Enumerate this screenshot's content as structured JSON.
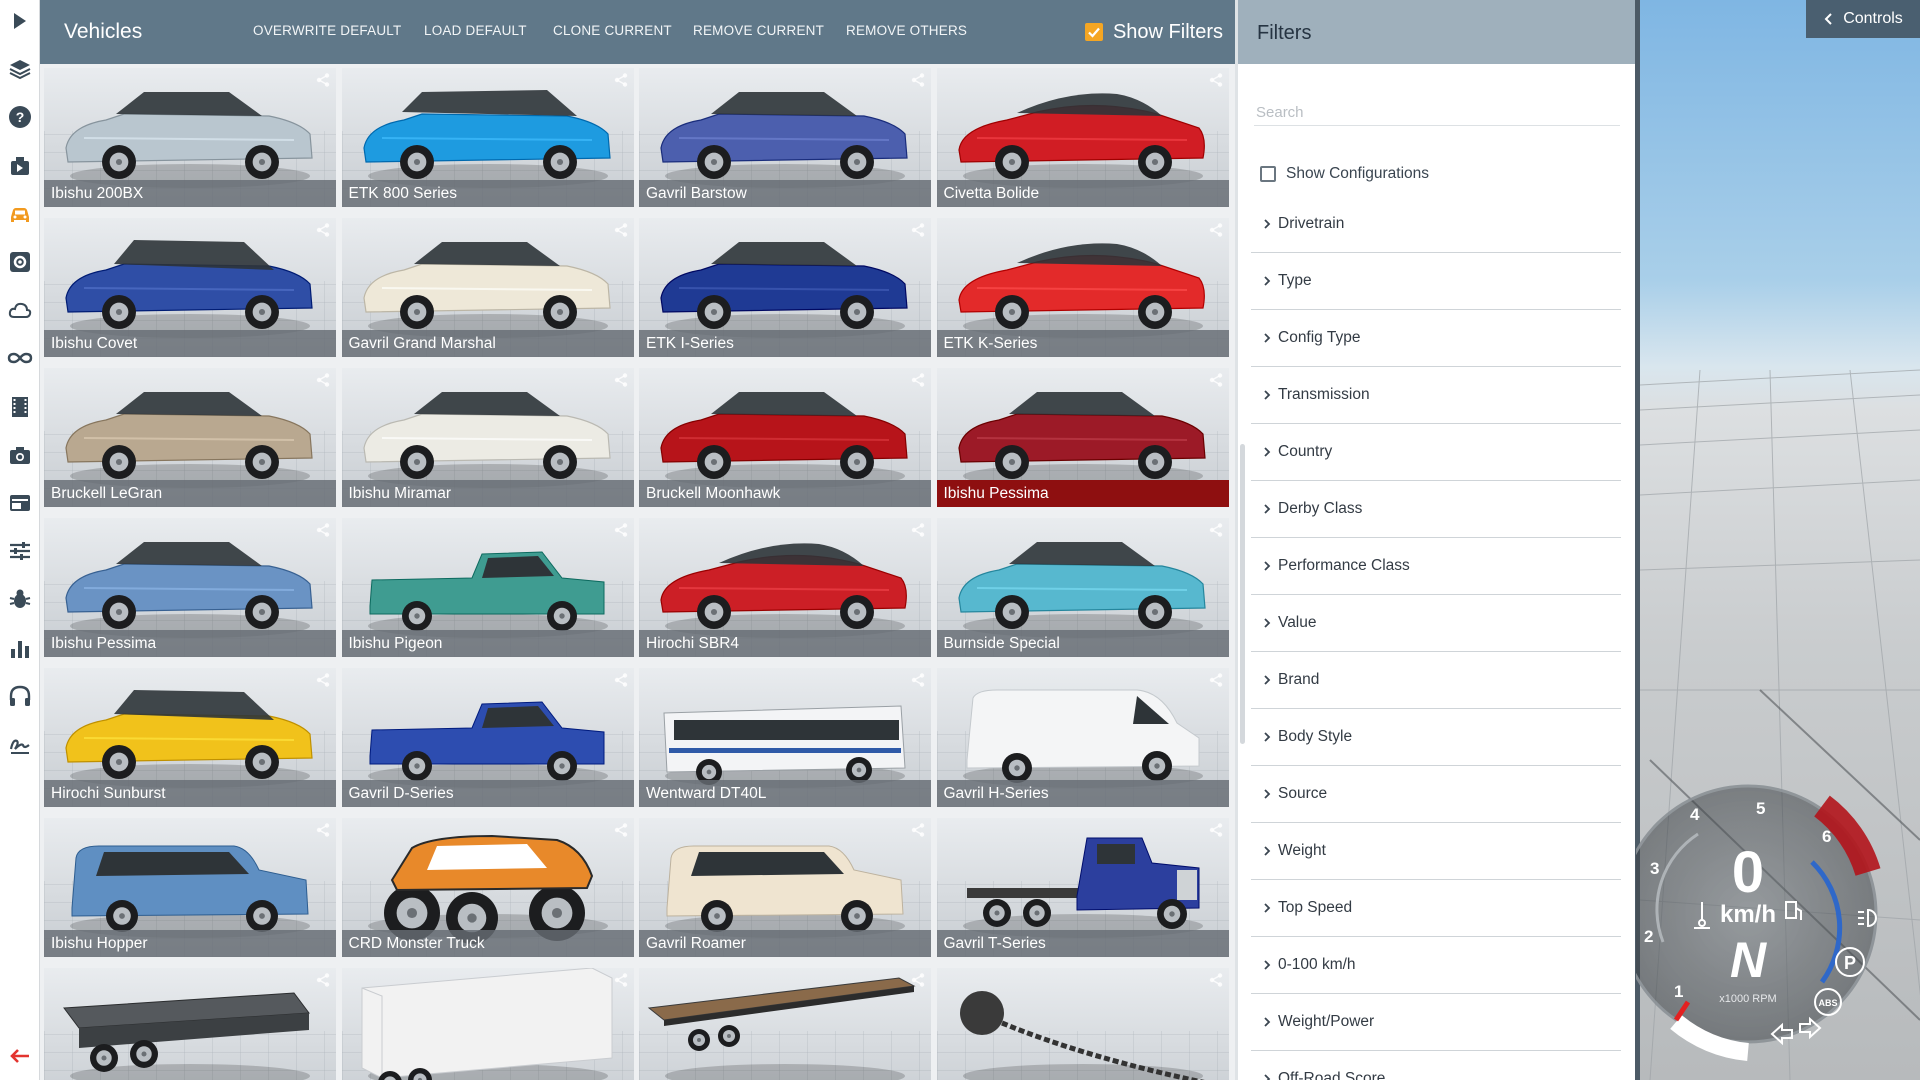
{
  "toolbar": {
    "items": [
      {
        "name": "play-icon"
      },
      {
        "name": "layers-icon"
      },
      {
        "name": "help-icon"
      },
      {
        "name": "scenario-icon"
      },
      {
        "name": "vehicle-icon"
      },
      {
        "name": "vehicle-config-icon"
      },
      {
        "name": "environment-icon"
      },
      {
        "name": "infinity-icon"
      },
      {
        "name": "film-icon"
      },
      {
        "name": "camera-icon"
      },
      {
        "name": "layout-icon"
      },
      {
        "name": "tune-icon"
      },
      {
        "name": "bug-icon"
      },
      {
        "name": "stats-icon"
      },
      {
        "name": "headset-icon"
      },
      {
        "name": "signature-icon"
      }
    ],
    "active": "vehicle-icon",
    "back_icon": "back-arrow-icon",
    "accent": "#f29a1f",
    "back_color": "#e3342f"
  },
  "vehicles_panel": {
    "title": "Vehicles",
    "actions": [
      "OVERWRITE DEFAULT",
      "LOAD DEFAULT",
      "CLONE CURRENT",
      "REMOVE CURRENT",
      "REMOVE OTHERS"
    ],
    "show_filters": {
      "label": "Show Filters",
      "checked": true,
      "color": "#f5a623"
    },
    "tiles": [
      {
        "label": "Ibishu 200BX",
        "color": "#b9c6cf",
        "shape": "coupe"
      },
      {
        "label": "ETK 800 Series",
        "color": "#1e9be0",
        "shape": "wagon"
      },
      {
        "label": "Gavril Barstow",
        "color": "#4c5fae",
        "shape": "coupe"
      },
      {
        "label": "Civetta Bolide",
        "color": "#d11d24",
        "shape": "sport"
      },
      {
        "label": "Ibishu Covet",
        "color": "#2f4ea6",
        "shape": "hatch"
      },
      {
        "label": "Gavril Grand Marshal",
        "color": "#eee8d8",
        "shape": "sedan"
      },
      {
        "label": "ETK I-Series",
        "color": "#1f3a94",
        "shape": "sedan"
      },
      {
        "label": "ETK K-Series",
        "color": "#e32a2a",
        "shape": "sport"
      },
      {
        "label": "Bruckell LeGran",
        "color": "#b9a890",
        "shape": "sedan"
      },
      {
        "label": "Ibishu Miramar",
        "color": "#ecebe4",
        "shape": "sedan"
      },
      {
        "label": "Bruckell Moonhawk",
        "color": "#b7141a",
        "shape": "coupe"
      },
      {
        "label": "Ibishu Pessima",
        "color": "#9c1a27",
        "shape": "sedan",
        "selected": true
      },
      {
        "label": "Ibishu Pessima",
        "color": "#6a93c4",
        "shape": "sedan"
      },
      {
        "label": "Ibishu Pigeon",
        "color": "#3f9c91",
        "shape": "pickup"
      },
      {
        "label": "Hirochi SBR4",
        "color": "#cc1f26",
        "shape": "sport"
      },
      {
        "label": "Burnside Special",
        "color": "#57b8cf",
        "shape": "sedan"
      },
      {
        "label": "Hirochi Sunburst",
        "color": "#f1c21b",
        "shape": "hatch"
      },
      {
        "label": "Gavril D-Series",
        "color": "#2d4db0",
        "shape": "pickup"
      },
      {
        "label": "Wentward DT40L",
        "color": "#f3f4f6",
        "shape": "bus"
      },
      {
        "label": "Gavril H-Series",
        "color": "#f4f5f6",
        "shape": "van"
      },
      {
        "label": "Ibishu Hopper",
        "color": "#5f8fc2",
        "shape": "suv"
      },
      {
        "label": "CRD Monster Truck",
        "color": "#e8892a",
        "shape": "monster"
      },
      {
        "label": "Gavril Roamer",
        "color": "#efe4d0",
        "shape": "suv"
      },
      {
        "label": "Gavril T-Series",
        "color": "#2c3f9e",
        "shape": "truck"
      },
      {
        "label": "",
        "color": "#4a4d50",
        "shape": "trailer"
      },
      {
        "label": "",
        "color": "#f2f2f2",
        "shape": "boxtrailer"
      },
      {
        "label": "",
        "color": "#8a6a4a",
        "shape": "flatbed"
      },
      {
        "label": "",
        "color": "#3a3a3a",
        "shape": "wreckingball"
      }
    ]
  },
  "filters_panel": {
    "title": "Filters",
    "search_placeholder": "Search",
    "show_configurations": {
      "label": "Show Configurations",
      "checked": false
    },
    "rows": [
      "Drivetrain",
      "Type",
      "Config Type",
      "Transmission",
      "Country",
      "Derby Class",
      "Performance Class",
      "Value",
      "Brand",
      "Body Style",
      "Source",
      "Weight",
      "Top Speed",
      "0-100 km/h",
      "Weight/Power",
      "Off-Road Score"
    ]
  },
  "viewport": {
    "controls_label": "Controls",
    "gauge": {
      "speed": "0",
      "speed_unit": "km/h",
      "gear": "N",
      "rpm_unit": "x1000 RPM",
      "rpm_ticks": [
        "1",
        "2",
        "3",
        "4",
        "5",
        "6"
      ],
      "indicators": [
        "P",
        "ABS"
      ],
      "redline_color": "#b3141b",
      "accent_color": "#2f68c9"
    }
  }
}
